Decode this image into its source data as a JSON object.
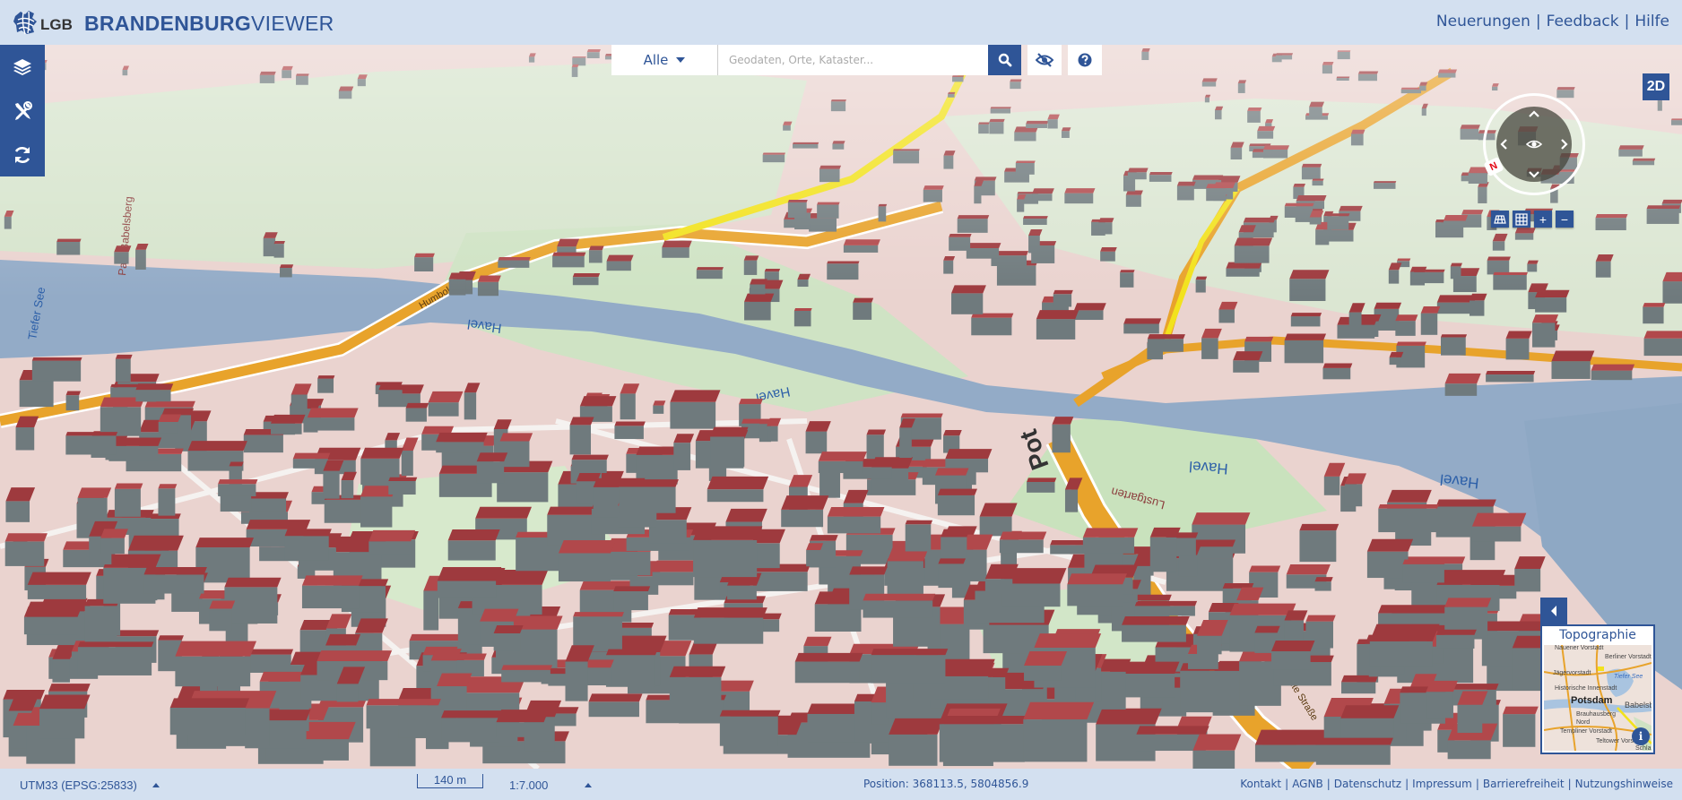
{
  "header": {
    "logo_text": "LGB",
    "brand_bold": "BRANDENBURG",
    "brand_light": "VIEWER",
    "links": [
      "Neuerungen",
      "Feedback",
      "Hilfe"
    ],
    "separator": "|"
  },
  "sidebar": {
    "items": [
      {
        "name": "layers",
        "icon": "layers-icon"
      },
      {
        "name": "tools",
        "icon": "tools-icon"
      },
      {
        "name": "reset",
        "icon": "refresh-icon"
      }
    ]
  },
  "search": {
    "category": "Alle",
    "placeholder": "Geodaten, Orte, Kataster...",
    "value": "",
    "search_icon": "search-icon",
    "hide_icon": "eye-slash-icon",
    "help_icon": "question-circle-icon"
  },
  "view": {
    "mode_button": "2D",
    "north_label": "N",
    "map_tools": [
      {
        "name": "perspective",
        "label": ""
      },
      {
        "name": "grid",
        "label": ""
      },
      {
        "name": "zoom-in",
        "label": "+"
      },
      {
        "name": "zoom-out",
        "label": "−"
      }
    ]
  },
  "map": {
    "labels": [
      {
        "text": "Havel",
        "name": "label-havel-1"
      },
      {
        "text": "Havel",
        "name": "label-havel-2"
      },
      {
        "text": "Havel",
        "name": "label-havel-3"
      },
      {
        "text": "Havel",
        "name": "label-havel-4"
      },
      {
        "text": "Tiefer See",
        "name": "label-tiefer-see"
      },
      {
        "text": "Park Babelsberg",
        "name": "label-park-babelsberg"
      },
      {
        "text": "Lustgarten",
        "name": "label-lustgarten"
      },
      {
        "text": "Breite Straße",
        "name": "label-breite-strasse"
      },
      {
        "text": "Humboldtring",
        "name": "label-humboldtring"
      },
      {
        "text": "Pot",
        "name": "label-potsdam-partial"
      }
    ],
    "colors": {
      "water": "#93abc7",
      "park": "#cfe2c3",
      "urban": "#ecd2cf",
      "road_major": "#e8a32b",
      "road_primary": "#f2e21c",
      "roof": "#9e3a3e",
      "wall": "#6f7a7d"
    }
  },
  "overview": {
    "title": "Topographie",
    "labels": [
      "Nauener Vorstadt",
      "Berliner Vorstadt",
      "Jägervorstadt",
      "Tiefer See",
      "Historische Innenstadt",
      "Potsdam",
      "Babelsberg",
      "Brauhausberg",
      "Nord",
      "Templiner Vorstadt",
      "Teltower Vorstadt",
      "Schla"
    ],
    "info_icon": "i"
  },
  "footer": {
    "crs": "UTM33 (EPSG:25833)",
    "scale_bar": "140 m",
    "scale": "1:7.000",
    "position_label": "Position:",
    "position_value": "368113.5, 5804856.9",
    "links": [
      "Kontakt",
      "AGNB",
      "Datenschutz",
      "Impressum",
      "Barrierefreiheit",
      "Nutzungshinweise"
    ],
    "separator": "|"
  }
}
